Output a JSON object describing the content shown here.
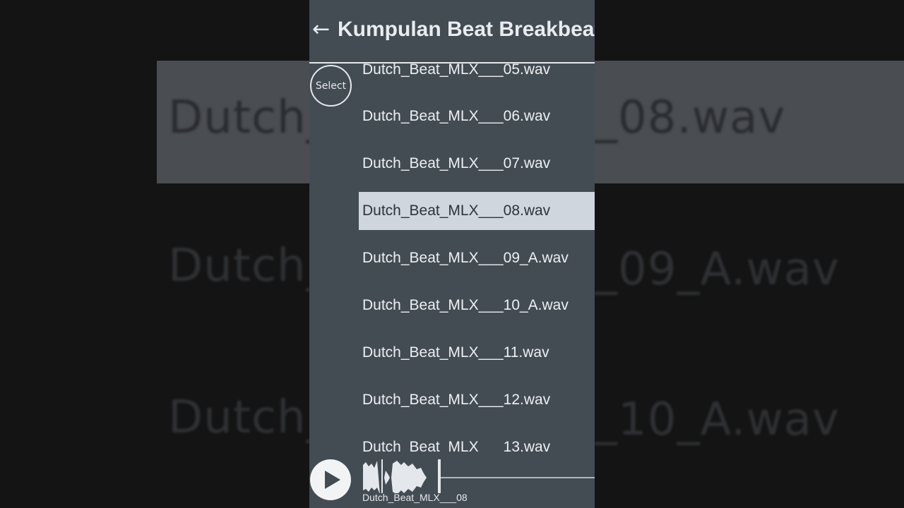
{
  "background": {
    "highlight_text": "Dutch_Beat_MLX___08.wav",
    "left_fragments": [
      "Dutch_",
      "Dutch_",
      "Dutch_"
    ],
    "right_fragments": [
      "_08.wav",
      "_09_A.wav",
      "_10_A.wav"
    ]
  },
  "header": {
    "back_icon": "←",
    "title": "Kumpulan Beat Breakbeat"
  },
  "select_label": "Select",
  "list": [
    {
      "name": "Dutch_Beat_MLX___05.wav",
      "selected": false
    },
    {
      "name": "Dutch_Beat_MLX___06.wav",
      "selected": false
    },
    {
      "name": "Dutch_Beat_MLX___07.wav",
      "selected": false
    },
    {
      "name": "Dutch_Beat_MLX___08.wav",
      "selected": true
    },
    {
      "name": "Dutch_Beat_MLX___09_A.wav",
      "selected": false
    },
    {
      "name": "Dutch_Beat_MLX___10_A.wav",
      "selected": false
    },
    {
      "name": "Dutch_Beat_MLX___11.wav",
      "selected": false
    },
    {
      "name": "Dutch_Beat_MLX___12.wav",
      "selected": false
    },
    {
      "name": "Dutch_Beat_MLX___13.wav",
      "selected": false
    }
  ],
  "player": {
    "track_name": "Dutch_Beat_MLX___08",
    "play_icon": "play-icon"
  },
  "colors": {
    "panel": "#434b53",
    "selected_row": "#cfd6de",
    "text": "#eef0f2"
  }
}
